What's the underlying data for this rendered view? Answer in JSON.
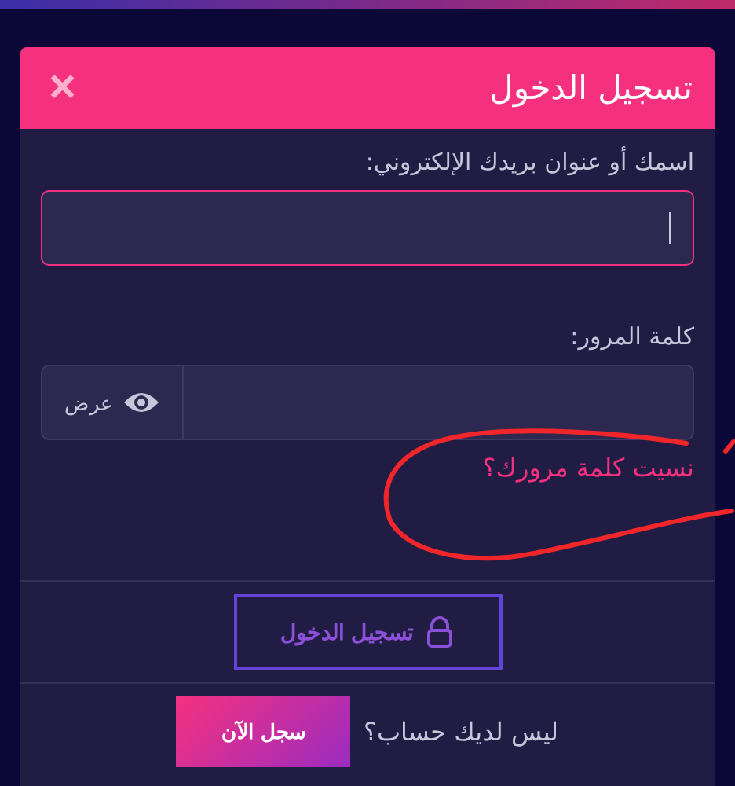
{
  "dialog": {
    "title": "تسجيل الدخول",
    "close": "×"
  },
  "username": {
    "label": "اسمك أو عنوان بريدك الإلكتروني:",
    "focused": true
  },
  "password": {
    "label": "كلمة المرور:",
    "show_label": "عرض"
  },
  "forgot_link": "نسيت كلمة مرورك؟",
  "login_button": "تسجيل الدخول",
  "register": {
    "prompt": "ليس لديك حساب؟",
    "button": "سجل الآن"
  }
}
